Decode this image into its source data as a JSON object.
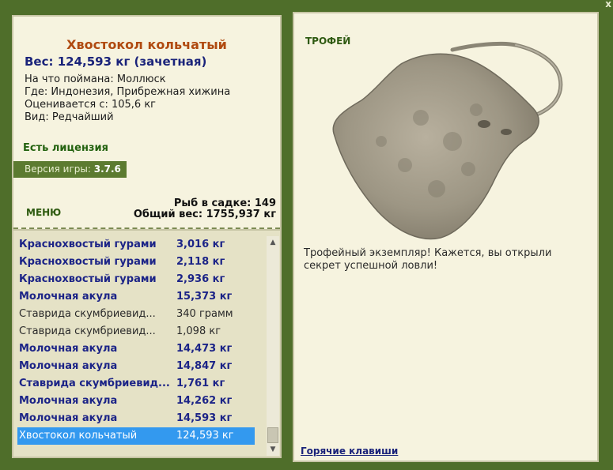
{
  "window": {
    "close_label": "x"
  },
  "fish": {
    "title": "Хвостокол кольчатый",
    "weight": "Вес: 124,593 кг (зачетная)",
    "info": [
      "На что поймана: Моллюск",
      "Где: Индонезия, Прибрежная хижина",
      "Оценивается с: 105,6 кг",
      "Вид: Редчайший"
    ]
  },
  "license": "Есть лицензия",
  "version": {
    "label": "Версия игры: ",
    "value": "3.7.6"
  },
  "menu_label": "МЕНЮ",
  "keepnet": {
    "count": "Рыб в садке: 149",
    "total": "Общий вес: 1755,937 кг"
  },
  "catch_list": [
    {
      "name": "Краснохвостый гурами",
      "weight": "3,016 кг",
      "style": "bold"
    },
    {
      "name": "Краснохвостый гурами",
      "weight": "2,118 кг",
      "style": "bold"
    },
    {
      "name": "Краснохвостый гурами",
      "weight": "2,936 кг",
      "style": "bold"
    },
    {
      "name": "Молочная акула",
      "weight": "15,373 кг",
      "style": "bold"
    },
    {
      "name": "Ставрида скумбриевид...",
      "weight": "340 грамм",
      "style": "plain"
    },
    {
      "name": "Ставрида скумбриевид...",
      "weight": "1,098 кг",
      "style": "plain"
    },
    {
      "name": "Молочная акула",
      "weight": "14,473 кг",
      "style": "bold"
    },
    {
      "name": "Молочная акула",
      "weight": "14,847 кг",
      "style": "bold"
    },
    {
      "name": "Ставрида скумбриевид...",
      "weight": "1,761 кг",
      "style": "bold"
    },
    {
      "name": "Молочная акула",
      "weight": "14,262 кг",
      "style": "bold"
    },
    {
      "name": "Молочная акула",
      "weight": "14,593 кг",
      "style": "bold"
    },
    {
      "name": "Хвостокол кольчатый",
      "weight": "124,593 кг",
      "style": "selected"
    }
  ],
  "trophy": {
    "label": "ТРОФЕЙ",
    "image_icon": "stingray-image",
    "text": "Трофейный экземпляр! Кажется, вы открыли секрет успешной ловли!"
  },
  "hotkeys_label": "Горячие клавиши",
  "colors": {
    "background": "#4f6e2a",
    "panel": "#f6f3df",
    "title": "#b04a10",
    "accent_blue": "#1a237a",
    "selected_row": "#3399ef"
  }
}
